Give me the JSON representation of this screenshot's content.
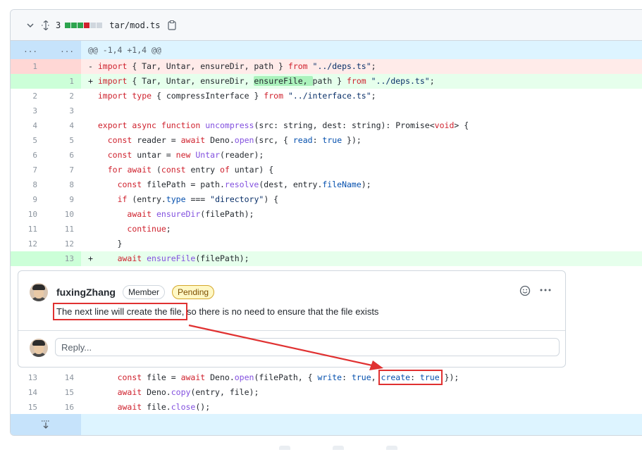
{
  "file_header": {
    "changes": "3",
    "path": "tar/mod.ts",
    "bar_colors": [
      "#2da44e",
      "#2da44e",
      "#2da44e",
      "#cf222e",
      "#d0d7de",
      "#d0d7de"
    ]
  },
  "hunk_header": {
    "left": "...",
    "right": "...",
    "text": "@@ -1,4 +1,4 @@"
  },
  "lines": [
    {
      "type": "del",
      "old": "1",
      "new": "",
      "prefix": "-",
      "segments": [
        [
          "kw",
          "import"
        ],
        [
          "",
          " { Tar, Untar, ensureDir, path } "
        ],
        [
          "kw",
          "from"
        ],
        [
          "",
          " "
        ],
        [
          "str",
          "\"../deps.ts\""
        ],
        [
          "",
          ";"
        ]
      ]
    },
    {
      "type": "add",
      "old": "",
      "new": "1",
      "prefix": "+",
      "segments": [
        [
          "kw",
          "import"
        ],
        [
          "",
          " { Tar, Untar, ensureDir, "
        ],
        [
          "hl",
          "ensureFile, "
        ],
        [
          "",
          "path } "
        ],
        [
          "kw",
          "from"
        ],
        [
          "",
          " "
        ],
        [
          "str",
          "\"../deps.ts\""
        ],
        [
          "",
          ";"
        ]
      ]
    },
    {
      "type": "ctx",
      "old": "2",
      "new": "2",
      "prefix": " ",
      "segments": [
        [
          "kw",
          "import"
        ],
        [
          "",
          " "
        ],
        [
          "kw",
          "type"
        ],
        [
          "",
          " { compressInterface } "
        ],
        [
          "kw",
          "from"
        ],
        [
          "",
          " "
        ],
        [
          "str",
          "\"../interface.ts\""
        ],
        [
          "",
          ";"
        ]
      ]
    },
    {
      "type": "ctx",
      "old": "3",
      "new": "3",
      "prefix": " ",
      "segments": []
    },
    {
      "type": "ctx",
      "old": "4",
      "new": "4",
      "prefix": " ",
      "segments": [
        [
          "kw",
          "export"
        ],
        [
          "",
          " "
        ],
        [
          "kw",
          "async"
        ],
        [
          "",
          " "
        ],
        [
          "kw",
          "function"
        ],
        [
          "",
          " "
        ],
        [
          "fn",
          "uncompress"
        ],
        [
          "",
          "(src: string, dest: string): Promise<"
        ],
        [
          "kw",
          "void"
        ],
        [
          "",
          "> {"
        ]
      ]
    },
    {
      "type": "ctx",
      "old": "5",
      "new": "5",
      "prefix": " ",
      "segments": [
        [
          "",
          "  "
        ],
        [
          "kw",
          "const"
        ],
        [
          "",
          " reader = "
        ],
        [
          "kw",
          "await"
        ],
        [
          "",
          " Deno."
        ],
        [
          "fn",
          "open"
        ],
        [
          "",
          "(src, { "
        ],
        [
          "con",
          "read"
        ],
        [
          "",
          ": "
        ],
        [
          "con",
          "true"
        ],
        [
          "",
          " });"
        ]
      ]
    },
    {
      "type": "ctx",
      "old": "6",
      "new": "6",
      "prefix": " ",
      "segments": [
        [
          "",
          "  "
        ],
        [
          "kw",
          "const"
        ],
        [
          "",
          " untar = "
        ],
        [
          "kw",
          "new"
        ],
        [
          "",
          " "
        ],
        [
          "fn",
          "Untar"
        ],
        [
          "",
          "(reader);"
        ]
      ]
    },
    {
      "type": "ctx",
      "old": "7",
      "new": "7",
      "prefix": " ",
      "segments": [
        [
          "",
          "  "
        ],
        [
          "kw",
          "for"
        ],
        [
          "",
          " "
        ],
        [
          "kw",
          "await"
        ],
        [
          "",
          " ("
        ],
        [
          "kw",
          "const"
        ],
        [
          "",
          " entry "
        ],
        [
          "kw",
          "of"
        ],
        [
          "",
          " untar) {"
        ]
      ]
    },
    {
      "type": "ctx",
      "old": "8",
      "new": "8",
      "prefix": " ",
      "segments": [
        [
          "",
          "    "
        ],
        [
          "kw",
          "const"
        ],
        [
          "",
          " filePath = path."
        ],
        [
          "fn",
          "resolve"
        ],
        [
          "",
          "(dest, entry."
        ],
        [
          "con",
          "fileName"
        ],
        [
          "",
          ");"
        ]
      ]
    },
    {
      "type": "ctx",
      "old": "9",
      "new": "9",
      "prefix": " ",
      "segments": [
        [
          "",
          "    "
        ],
        [
          "kw",
          "if"
        ],
        [
          "",
          " (entry."
        ],
        [
          "con",
          "type"
        ],
        [
          "",
          " === "
        ],
        [
          "str",
          "\"directory\""
        ],
        [
          "",
          ") {"
        ]
      ]
    },
    {
      "type": "ctx",
      "old": "10",
      "new": "10",
      "prefix": " ",
      "segments": [
        [
          "",
          "      "
        ],
        [
          "kw",
          "await"
        ],
        [
          "",
          " "
        ],
        [
          "fn",
          "ensureDir"
        ],
        [
          "",
          "(filePath);"
        ]
      ]
    },
    {
      "type": "ctx",
      "old": "11",
      "new": "11",
      "prefix": " ",
      "segments": [
        [
          "",
          "      "
        ],
        [
          "kw",
          "continue"
        ],
        [
          "",
          ";"
        ]
      ]
    },
    {
      "type": "ctx",
      "old": "12",
      "new": "12",
      "prefix": " ",
      "segments": [
        [
          "",
          "    }"
        ]
      ]
    },
    {
      "type": "add",
      "old": "",
      "new": "13",
      "prefix": "+",
      "segments": [
        [
          "",
          "    "
        ],
        [
          "kw",
          "await"
        ],
        [
          "",
          " "
        ],
        [
          "fn",
          "ensureFile"
        ],
        [
          "",
          "(filePath);"
        ]
      ]
    }
  ],
  "comment": {
    "author": "fuxingZhang",
    "member_badge": "Member",
    "pending_badge": "Pending",
    "body_boxed": "The next line will create the file,",
    "body_rest": " so there is no need to ensure that the file exists",
    "reply_placeholder": "Reply..."
  },
  "lines_after": [
    {
      "type": "ctx",
      "old": "13",
      "new": "14",
      "prefix": " ",
      "segments": [
        [
          "",
          "    "
        ],
        [
          "kw",
          "const"
        ],
        [
          "",
          " file = "
        ],
        [
          "kw",
          "await"
        ],
        [
          "",
          " Deno."
        ],
        [
          "fn",
          "open"
        ],
        [
          "",
          "(filePath, { "
        ],
        [
          "con",
          "write"
        ],
        [
          "",
          ": "
        ],
        [
          "con",
          "true"
        ],
        [
          "",
          ", "
        ],
        [
          "box",
          "create: true"
        ],
        [
          "",
          " });"
        ]
      ]
    },
    {
      "type": "ctx",
      "old": "14",
      "new": "15",
      "prefix": " ",
      "segments": [
        [
          "",
          "    "
        ],
        [
          "kw",
          "await"
        ],
        [
          "",
          " Deno."
        ],
        [
          "fn",
          "copy"
        ],
        [
          "",
          "(entry, file);"
        ]
      ]
    },
    {
      "type": "ctx",
      "old": "15",
      "new": "16",
      "prefix": " ",
      "segments": [
        [
          "",
          "    "
        ],
        [
          "kw",
          "await"
        ],
        [
          "",
          " file."
        ],
        [
          "fn",
          "close"
        ],
        [
          "",
          "();"
        ]
      ]
    }
  ],
  "annotation_color": "#e03131"
}
